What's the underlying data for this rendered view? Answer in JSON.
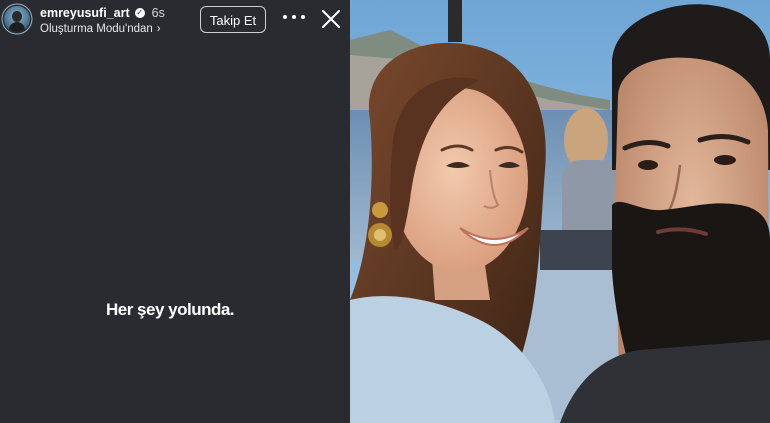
{
  "story": {
    "username": "emreyusufi_art",
    "timestamp": "6s",
    "subtitle": "Oluşturma Modu'ndan",
    "subtitle_chevron": "›",
    "follow_label": "Takip Et",
    "caption": "Her şey yolunda."
  },
  "icons": {
    "verified": "verified-badge-icon",
    "more": "more-options-icon",
    "close": "close-icon"
  },
  "colors": {
    "story_background": "#2a2b30",
    "text": "#ffffff"
  }
}
